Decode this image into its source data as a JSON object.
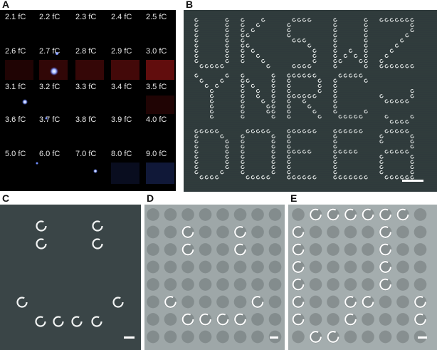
{
  "panel_labels": {
    "a": "A",
    "b": "B",
    "c": "C",
    "d": "D",
    "e": "E"
  },
  "panel_a": {
    "charge_labels": [
      "2.1 fC",
      "2.2 fC",
      "2.3 fC",
      "2.4 fC",
      "2.5 fC",
      "2.6 fC",
      "2.7 fC",
      "2.8 fC",
      "2.9 fC",
      "3.0 fC",
      "3.1 fC",
      "3.2 fC",
      "3.3 fC",
      "3.4 fC",
      "3.5 fC",
      "3.6 fC",
      "3.7 fC",
      "3.8 fC",
      "3.9 fC",
      "4.0 fC",
      "5.0 fC",
      "6.0 fC",
      "7.0 fC",
      "8.0 fC",
      "9.0 fC"
    ],
    "colors": {
      "background": "#000000",
      "label": "#e9e9e9",
      "glow_red": "#b01818",
      "glow_blue": "#4a6cff"
    }
  },
  "panel_b": {
    "colors": {
      "background": "#2f3a3c",
      "ring": "#e8eceb"
    }
  },
  "panel_c": {
    "colors": {
      "background": "#3a4547",
      "ring": "#f2f4f4"
    }
  },
  "panel_d": {
    "colors": {
      "background": "#9ea7a8",
      "hole": "#838c8d",
      "ring": "#ffffff"
    }
  },
  "panel_e": {
    "colors": {
      "background": "#a4adae",
      "hole": "#878f90",
      "ring": "#ffffff"
    }
  }
}
